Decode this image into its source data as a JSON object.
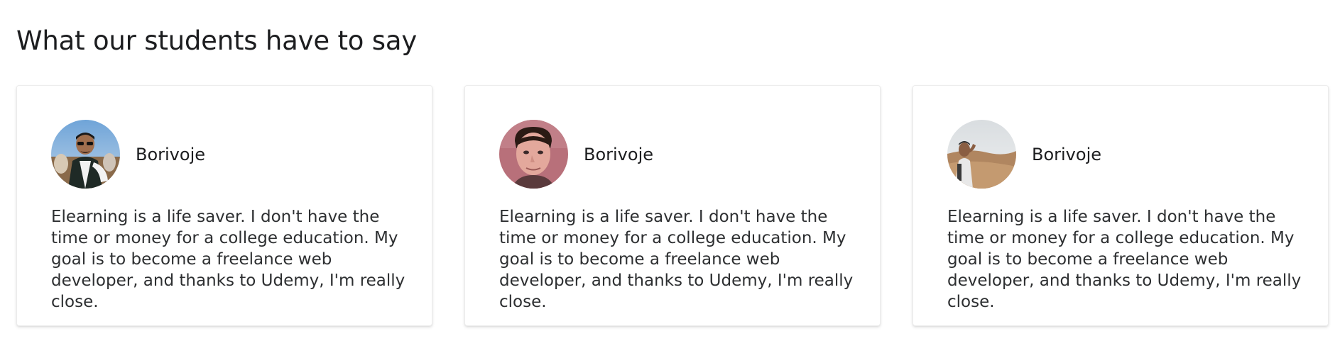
{
  "section": {
    "title": "What our students have to say"
  },
  "testimonials": [
    {
      "name": "Borivoje",
      "avatar_icon": "student-photo-sunglasses",
      "quote": "Elearning is a life saver. I don't have the time or money for a college education. My goal is to become a freelance web developer, and thanks to Udemy, I'm really close."
    },
    {
      "name": "Borivoje",
      "avatar_icon": "student-photo-portrait",
      "quote": "Elearning is a life saver. I don't have the time or money for a college education. My goal is to become a freelance web developer, and thanks to Udemy, I'm really close."
    },
    {
      "name": "Borivoje",
      "avatar_icon": "student-photo-desert",
      "quote": "Elearning is a life saver. I don't have the time or money for a college education. My goal is to become a freelance web developer, and thanks to Udemy, I'm really close."
    }
  ],
  "colors": {
    "text": "#1c1d1f",
    "card_border": "#ececec",
    "background": "#ffffff"
  }
}
